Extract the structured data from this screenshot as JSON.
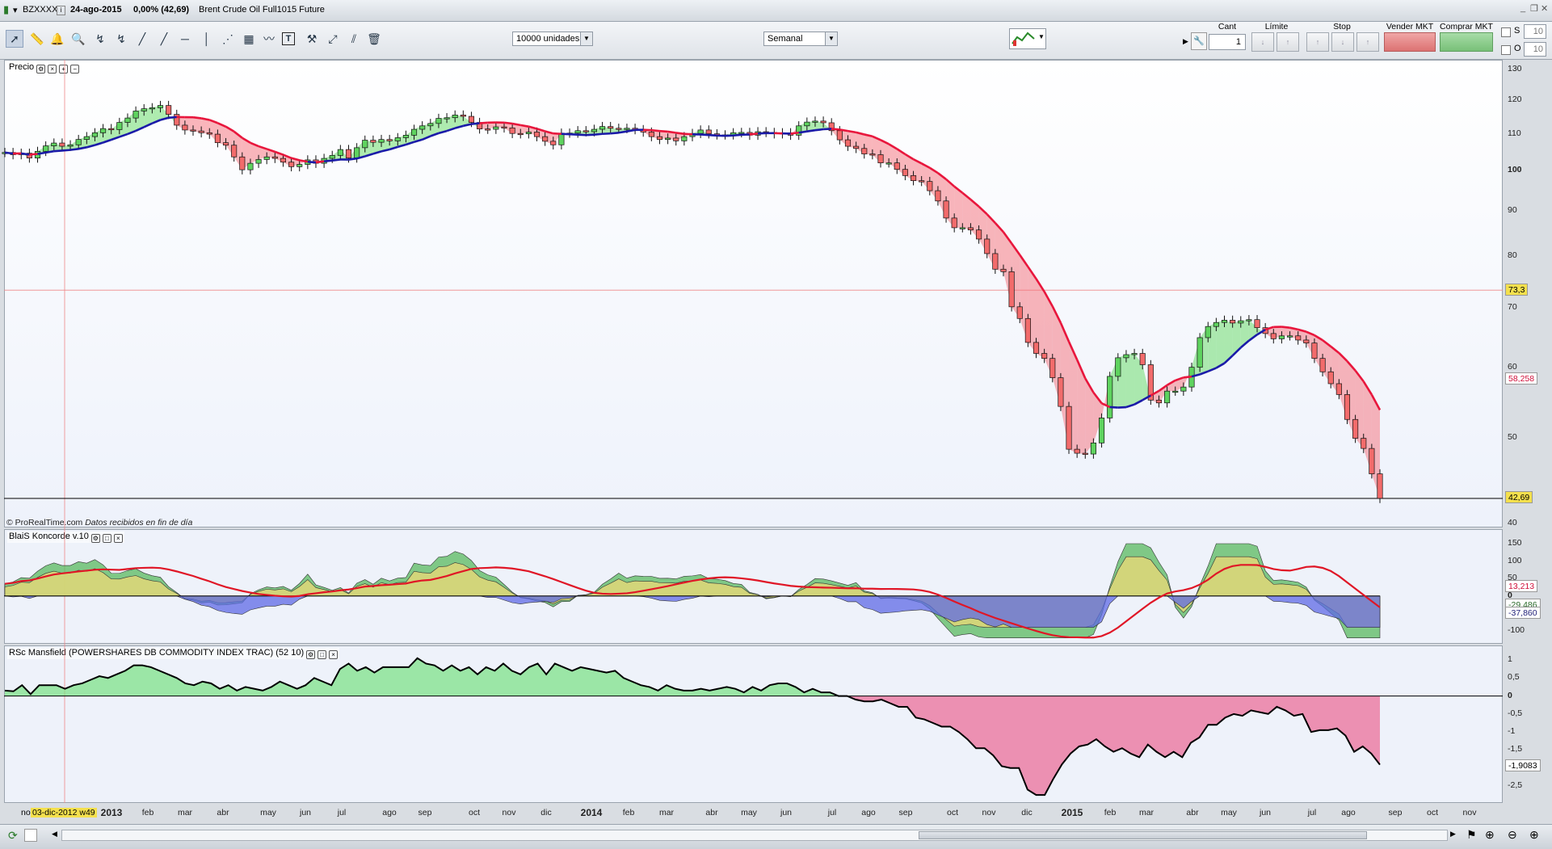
{
  "titlebar": {
    "symbol": "BZXXXX",
    "date_change": "24-ago-2015",
    "change_pct": "0,00% (42,69)",
    "instrument": "Brent Crude Oil Full1015 Future"
  },
  "toolbar": {
    "quantity_select": "10000 unidades",
    "period_select": "Semanal"
  },
  "order_panel": {
    "cant_label": "Cant",
    "cant_value": "1",
    "limite_label": "Límite",
    "stop_label": "Stop",
    "sell_label": "Vender MKT",
    "buy_label": "Comprar MKT",
    "s_label": "S",
    "s_value": "10",
    "o_label": "O",
    "o_value": "10"
  },
  "colors": {
    "candle_up": "#5fd35f",
    "candle_down": "#f26b6b",
    "ma_above": "#1a1aa8",
    "ma_below": "#e8163c",
    "rsc_line": "#000000"
  },
  "panels": {
    "price": {
      "label": "Precio",
      "watermark": "© ProRealTime.com",
      "watermark_note": "Datos recibidos en fin de día",
      "yticks": [
        "130",
        "120",
        "110",
        "100",
        "90",
        "80",
        "70",
        "60",
        "50",
        "40"
      ],
      "badge_cursor": "73,3",
      "badge_ma": "58,258",
      "badge_last": "42,69"
    },
    "koncorde": {
      "label": "BlaiS Koncorde v.10",
      "yticks": [
        "150",
        "100",
        "50",
        "0",
        "-50",
        "-100"
      ],
      "badge_a": "13,213",
      "badge_b": "-29,486",
      "badge_c": "-37,860"
    },
    "rsc": {
      "label": "RSc Mansfield (POWERSHARES DB COMMODITY INDEX TRAC) (52 10)",
      "yticks": [
        "1",
        "0,5",
        "0",
        "-0,5",
        "-1",
        "-1,5",
        "-2",
        "-2,5"
      ],
      "badge_last": "-1,9083"
    }
  },
  "xaxis": {
    "cursor_label": "03-dic-2012 w49",
    "first_partial": "no"
  },
  "chart_data": [
    {
      "type": "candlestick",
      "title": "Brent Crude Oil Full1015 Future",
      "period": "weekly",
      "ylim": [
        40,
        132
      ],
      "y_scale": "log",
      "grid": false,
      "x_labels": [
        "2013",
        "feb",
        "mar",
        "abr",
        "may",
        "jun",
        "jul",
        "ago",
        "sep",
        "oct",
        "nov",
        "dic",
        "2014",
        "feb",
        "mar",
        "abr",
        "may",
        "jun",
        "jul",
        "ago",
        "sep",
        "oct",
        "nov",
        "dic",
        "2015",
        "feb",
        "mar",
        "abr",
        "may",
        "jun",
        "jul",
        "ago",
        "sep",
        "oct",
        "nov"
      ],
      "close_series": [
        {
          "name": "Precio",
          "values": [
            104.8,
            104.2,
            104.6,
            103.3,
            105.1,
            106.6,
            107.4,
            106.5,
            106.9,
            108.4,
            109.2,
            110.3,
            111.5,
            111.2,
            113.3,
            114.6,
            116.7,
            117.4,
            117.7,
            118.4,
            115.7,
            112.5,
            111.1,
            110.8,
            110.3,
            109.9,
            107.5,
            106.8,
            103.6,
            100.2,
            101.9,
            102.9,
            103.6,
            103.2,
            102.2,
            101.0,
            101.6,
            102.8,
            101.9,
            103.2,
            104.0,
            105.6,
            103.3,
            106.1,
            108.2,
            107.6,
            108.4,
            108.0,
            108.9,
            109.6,
            111.3,
            112.3,
            113.0,
            114.5,
            114.7,
            115.5,
            115.1,
            113.3,
            111.4,
            111.3,
            112.0,
            111.7,
            110.1,
            110.0,
            110.5,
            109.2,
            107.9,
            106.9,
            110.2,
            110.2,
            110.9,
            110.6,
            111.3,
            112.1,
            111.6,
            111.5,
            111.6,
            111.2,
            110.5,
            109.2,
            108.4,
            108.8,
            108.0,
            109.2,
            110.1,
            111.1,
            110.0,
            109.7,
            109.7,
            110.3,
            110.4,
            109.6,
            110.6,
            110.4,
            110.0,
            110.3,
            109.6,
            112.3,
            113.4,
            113.7,
            113.2,
            110.9,
            108.3,
            106.5,
            105.9,
            104.4,
            104.2,
            102.0,
            102.0,
            100.3,
            98.7,
            97.4,
            97.2,
            94.9,
            92.4,
            88.4,
            86.2,
            86.2,
            85.7,
            83.7,
            80.6,
            77.4,
            76.9,
            70.2,
            68.1,
            64.0,
            62.2,
            61.4,
            58.4,
            54.2,
            48.5,
            48.0,
            47.9,
            49.3,
            52.6,
            58.6,
            61.5,
            62.0,
            62.2,
            60.4,
            55.1,
            54.7,
            56.4,
            56.4,
            57.0,
            60.0,
            64.8,
            66.7,
            67.4,
            67.8,
            67.3,
            67.7,
            67.9,
            66.5,
            65.5,
            64.6,
            65.1,
            65.1,
            64.4,
            63.9,
            61.4,
            59.3,
            57.5,
            55.9,
            52.4,
            49.9,
            48.6,
            45.5,
            42.69
          ]
        }
      ],
      "ma_series": {
        "name": "MA",
        "last": 58.258
      },
      "last_price": 42.69,
      "cursor_price": 73.3
    },
    {
      "type": "area",
      "title": "BlaiS Koncorde v.10",
      "ylim": [
        -120,
        160
      ],
      "series": [
        {
          "name": "",
          "last": 13.213
        },
        {
          "name": "",
          "last": -29.486
        },
        {
          "name": "",
          "last": -37.86
        }
      ]
    },
    {
      "type": "line",
      "title": "RSc Mansfield (POWERSHARES DB COMMODITY INDEX TRAC) (52 10)",
      "ylim": [
        -2.9,
        1.15
      ],
      "series": [
        {
          "name": "",
          "values": [
            0.15,
            0.13,
            0.3,
            0.05,
            0.3,
            0.3,
            0.3,
            0.2,
            0.3,
            0.35,
            0.45,
            0.55,
            0.5,
            0.6,
            0.7,
            0.85,
            0.85,
            0.8,
            0.7,
            0.6,
            0.5,
            0.35,
            0.3,
            0.4,
            0.35,
            0.2,
            0.3,
            0.15,
            0.25,
            0.2,
            0.15,
            0.25,
            0.4,
            0.3,
            0.2,
            0.3,
            0.5,
            0.4,
            0.3,
            0.75,
            0.9,
            0.7,
            0.8,
            0.65,
            0.8,
            0.8,
            0.8,
            0.8,
            1.05,
            0.9,
            0.85,
            0.7,
            0.85,
            0.7,
            0.8,
            0.6,
            0.8,
            0.7,
            0.9,
            0.7,
            0.6,
            0.8,
            0.9,
            0.6,
            0.9,
            0.8,
            0.7,
            0.8,
            0.75,
            0.7,
            0.65,
            0.7,
            0.5,
            0.4,
            0.3,
            0.25,
            0.15,
            0.3,
            0.2,
            0.15,
            0.15,
            0.2,
            0.15,
            0.2,
            0.25,
            0.2,
            0.1,
            0.25,
            0.15,
            0.3,
            0.35,
            0.35,
            0.25,
            0.1,
            0.2,
            0.1,
            0.1,
            0.0,
            0.0,
            -0.1,
            -0.15,
            -0.15,
            -0.1,
            -0.2,
            -0.3,
            -0.3,
            -0.6,
            -0.65,
            -0.75,
            -0.85,
            -0.85,
            -1.0,
            -1.2,
            -1.45,
            -1.45,
            -1.65,
            -1.95,
            -2.0,
            -2.0,
            -2.6,
            -2.75,
            -2.75,
            -2.3,
            -1.9,
            -1.6,
            -1.4,
            -1.35,
            -1.2,
            -1.4,
            -1.55,
            -1.45,
            -1.6,
            -1.7,
            -1.35,
            -1.55,
            -1.7,
            -1.55,
            -1.7,
            -1.3,
            -1.15,
            -0.8,
            -0.8,
            -0.6,
            -0.5,
            -0.55,
            -0.4,
            -0.45,
            -0.5,
            -0.3,
            -0.4,
            -0.55,
            -0.5,
            -1.0,
            -0.95,
            -0.95,
            -0.9,
            -1.1,
            -1.55,
            -1.4,
            -1.6,
            -1.9083
          ]
        }
      ]
    }
  ]
}
